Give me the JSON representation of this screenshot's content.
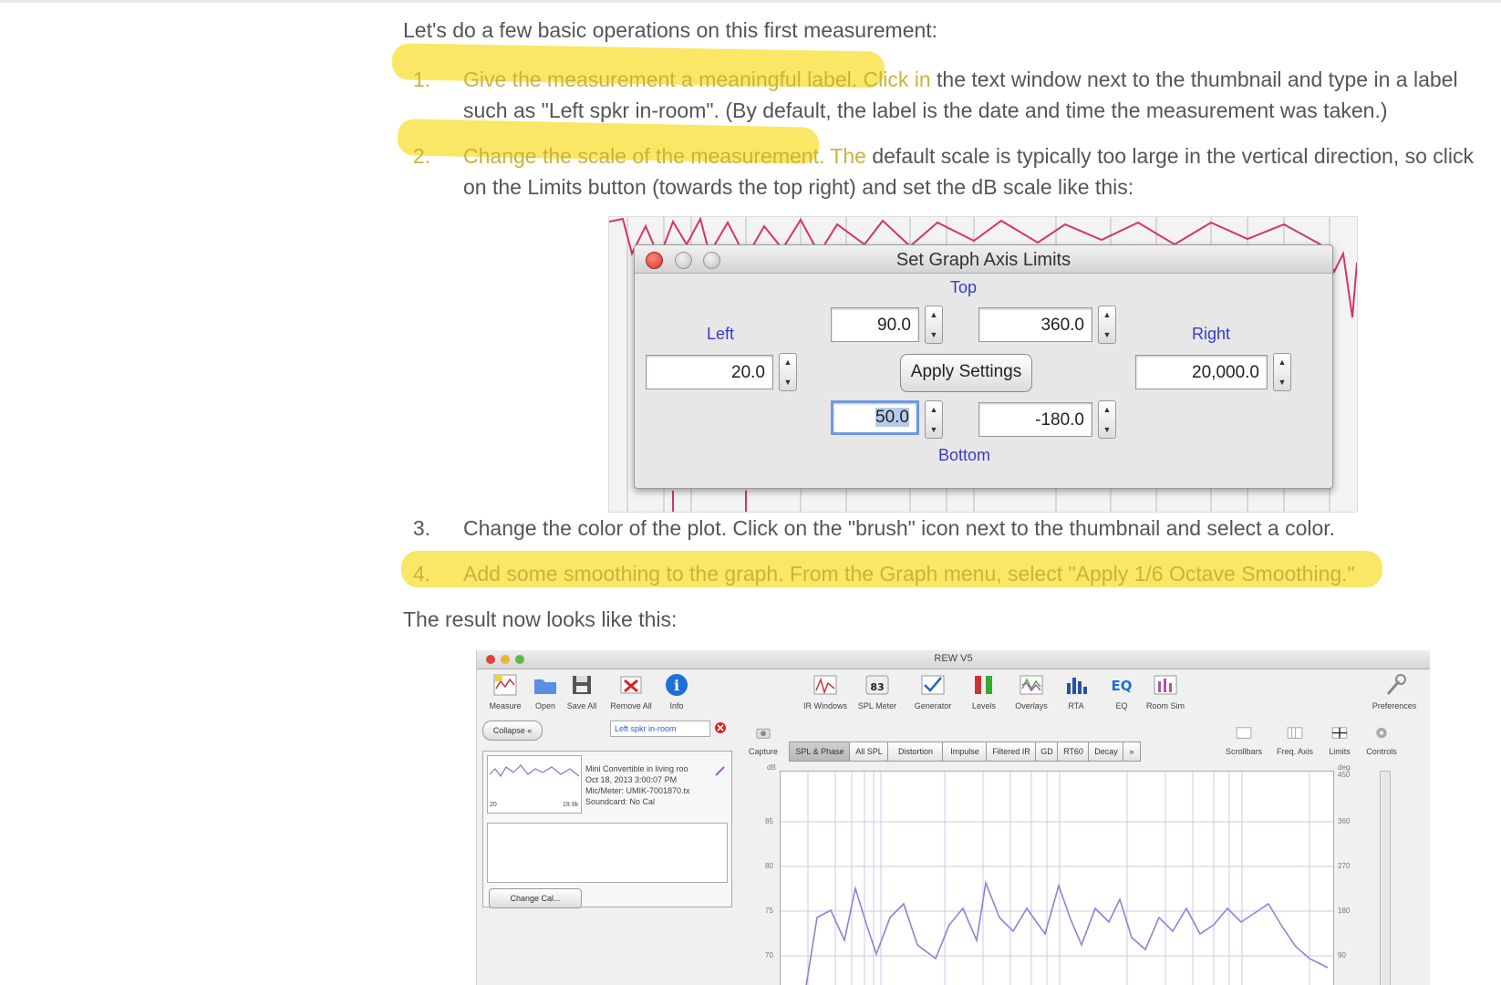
{
  "doc": {
    "intro": "Let's do a few basic operations on this first measurement:",
    "steps": [
      {
        "num": "1.",
        "highlight": "Give the measurement a meaningful label. Click in",
        "line1_rest": "the text window next to the thumbnail and type in a label",
        "line2": "such as \"Left spkr in-room\". (By default, the label is the date and time the measurement was taken.)"
      },
      {
        "num": "2.",
        "highlight": "Change the scale of the measurement. The",
        "line1_rest": "default scale is typically too large in the vertical direction, so click",
        "line2": "on the Limits button (towards the top right) and set the dB scale like this:"
      },
      {
        "num": "3.",
        "line1": "Change the color of the plot. Click on the \"brush\" icon next to the thumbnail and select a color."
      },
      {
        "num": "4.",
        "highlight": "Add some smoothing to the graph. From the Graph menu, select \"Apply 1/6 Octave Smoothing.\""
      }
    ],
    "result": "The result now looks like this:"
  },
  "dialog": {
    "title": "Set Graph Axis Limits",
    "top_label": "Top",
    "bottom_label": "Bottom",
    "left_label": "Left",
    "right_label": "Right",
    "top_left_value": "90.0",
    "top_right_value": "360.0",
    "left_value": "20.0",
    "right_value": "20,000.0",
    "bottom_left_value": "50.0",
    "bottom_right_value": "-180.0",
    "apply_label": "Apply Settings"
  },
  "rew": {
    "title": "REW V5",
    "toolbar_left": [
      "Measure",
      "Open",
      "Save All",
      "Remove All",
      "Info"
    ],
    "toolbar_mid": [
      "IR Windows",
      "SPL Meter",
      "Generator",
      "Levels",
      "Overlays",
      "RTA",
      "EQ",
      "Room Sim"
    ],
    "preferences": "Preferences",
    "spl_value": "83",
    "collapse": "Collapse",
    "label_field": "Left spkr in-room",
    "meas_info": [
      "Mini Convertible in living roo",
      "Oct 18, 2013 3:00:07 PM",
      "Mic/Meter: UMIK-7001870.tx",
      "Soundcard: No Cal"
    ],
    "thumb_low": "20",
    "thumb_high": "19.9k",
    "change_cal": "Change Cal...",
    "capture": "Capture",
    "tabs": [
      "SPL & Phase",
      "All SPL",
      "Distortion",
      "Impulse",
      "Filtered IR",
      "GD",
      "RT60",
      "Decay",
      "»"
    ],
    "right_tools": [
      "Scrollbars",
      "Freq. Axis",
      "Limits",
      "Controls"
    ],
    "y_left": [
      "85",
      "80",
      "75",
      "70"
    ],
    "y_left_unit": "dB",
    "y_right": [
      "450",
      "360",
      "270",
      "180",
      "90"
    ],
    "y_right_unit": "deg"
  },
  "colors": {
    "highlight": "#f8e34a",
    "highlight_text": "#c9b33c",
    "trace_red": "#d6336c",
    "trace_blue": "#8a85d6",
    "dialog_blue_label": "#3a3acc"
  }
}
